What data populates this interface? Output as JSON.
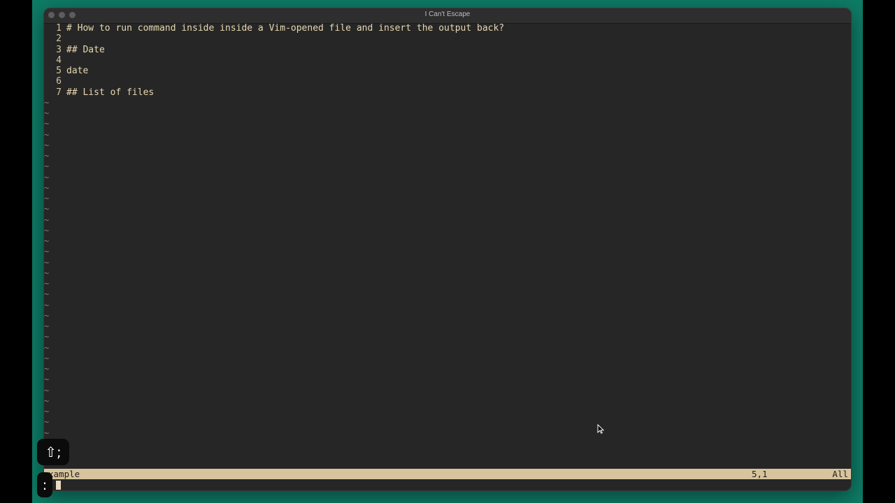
{
  "window": {
    "title": "I Can't Escape"
  },
  "editor": {
    "lines": [
      {
        "num": "1",
        "text": "# How to run command inside inside a Vim-opened file and insert the output back?"
      },
      {
        "num": "2",
        "text": ""
      },
      {
        "num": "3",
        "text": "## Date"
      },
      {
        "num": "4",
        "text": ""
      },
      {
        "num": "5",
        "text": "date"
      },
      {
        "num": "6",
        "text": ""
      },
      {
        "num": "7",
        "text": "## List of files"
      }
    ],
    "tilde": "~"
  },
  "statusline": {
    "filename": "xample",
    "position": "5,1",
    "scroll": "All"
  },
  "keycast": {
    "combo": "⇧;",
    "pressed": ":"
  },
  "colors": {
    "background": "#0e7c66",
    "editor_bg": "#262626",
    "text": "#e8d8b0",
    "statusline": "#d7c49c"
  }
}
